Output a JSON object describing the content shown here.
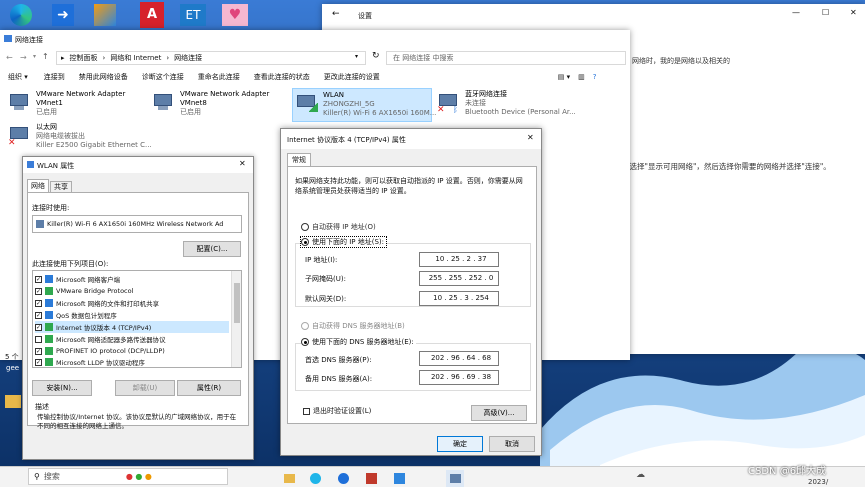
{
  "taskbar": {
    "search_placeholder": "搜索",
    "time": "2023/",
    "csdn": "CSDN @6邱大成"
  },
  "settings": {
    "title": "设置",
    "body_line_1": "网络时，我的是网络以及相关的",
    "body_line_2": "请选择\"显示可用网络\"，然后选择你需要的网络并选择\"连接\"。"
  },
  "netconn": {
    "title": "网络连接",
    "breadcrumb": [
      "控制面板",
      "网络和 Internet",
      "网络连接"
    ],
    "search_placeholder": "在 网络连接 中搜索",
    "toolbar": [
      "组织 ▾",
      "连接到",
      "禁用此网络设备",
      "诊断这个连接",
      "重命名此连接",
      "查看此连接的状态",
      "更改此连接的设置"
    ],
    "adapters": [
      {
        "name": "VMware Network Adapter VMnet1",
        "status": "已启用",
        "device": ""
      },
      {
        "name": "VMware Network Adapter VMnet8",
        "status": "已启用",
        "device": ""
      },
      {
        "name": "WLAN",
        "status": "ZHONGZHI_5G",
        "device": "Killer(R) Wi-Fi 6 AX1650i 160M..."
      },
      {
        "name": "蓝牙网络连接",
        "status": "未连接",
        "device": "Bluetooth Device (Personal Ar..."
      },
      {
        "name": "以太网",
        "status": "网络电缆被拔出",
        "device": "Killer E2500 Gigabit Ethernet C..."
      }
    ],
    "status_count": "5 个",
    "status_left_2": "gee"
  },
  "wlan": {
    "title": "WLAN 属性",
    "tabs": [
      "网络",
      "共享"
    ],
    "connect_using_label": "连接时使用:",
    "adapter_name": "Killer(R) Wi-Fi 6 AX1650i 160MHz Wireless Network Ad",
    "configure_button": "配置(C)...",
    "items_label": "此连接使用下列项目(O):",
    "items": [
      {
        "label": "Microsoft 网络客户端",
        "checked": true
      },
      {
        "label": "VMware Bridge Protocol",
        "checked": true
      },
      {
        "label": "Microsoft 网络的文件和打印机共享",
        "checked": true
      },
      {
        "label": "QoS 数据包计划程序",
        "checked": true
      },
      {
        "label": "Internet 协议版本 4 (TCP/IPv4)",
        "checked": true
      },
      {
        "label": "Microsoft 网络适配器多路传送器协议",
        "checked": false
      },
      {
        "label": "PROFINET IO protocol (DCP/LLDP)",
        "checked": true
      },
      {
        "label": "Microsoft LLDP 协议驱动程序",
        "checked": true
      }
    ],
    "install_button": "安装(N)...",
    "uninstall_button": "卸载(U)",
    "properties_button": "属性(R)",
    "description_label": "描述",
    "description": "传输控制协议/Internet 协议。该协议是默认的广域网络协议，用于在不同的相互连接的网络上通信。"
  },
  "ipv4": {
    "title": "Internet 协议版本 4 (TCP/IPv4) 属性",
    "tab": "常规",
    "intro": "如果网络支持此功能，则可以获取自动指派的 IP 设置。否则，你需要从网络系统管理员处获得适当的 IP 设置。",
    "auto_ip": "自动获得 IP 地址(O)",
    "manual_ip": "使用下面的 IP 地址(S):",
    "ip_label": "IP 地址(I):",
    "ip": "10 . 25 . 2 . 37",
    "mask_label": "子网掩码(U):",
    "mask": "255 . 255 . 252 . 0",
    "gw_label": "默认网关(D):",
    "gw": "10 . 25 . 3 . 254",
    "auto_dns": "自动获得 DNS 服务器地址(B)",
    "manual_dns": "使用下面的 DNS 服务器地址(E):",
    "dns1_label": "首选 DNS 服务器(P):",
    "dns1": "202 . 96 . 64 . 68",
    "dns2_label": "备用 DNS 服务器(A):",
    "dns2": "202 . 96 . 69 . 38",
    "validate": "退出时验证设置(L)",
    "advanced_button": "高级(V)...",
    "ok_button": "确定",
    "cancel_button": "取消"
  },
  "colors": {
    "wallpaper_dark": "#0b2f63",
    "wallpaper_mid": "#1f5fa8",
    "accent": "#0078d7",
    "taskbar": "#f3f3f3"
  }
}
